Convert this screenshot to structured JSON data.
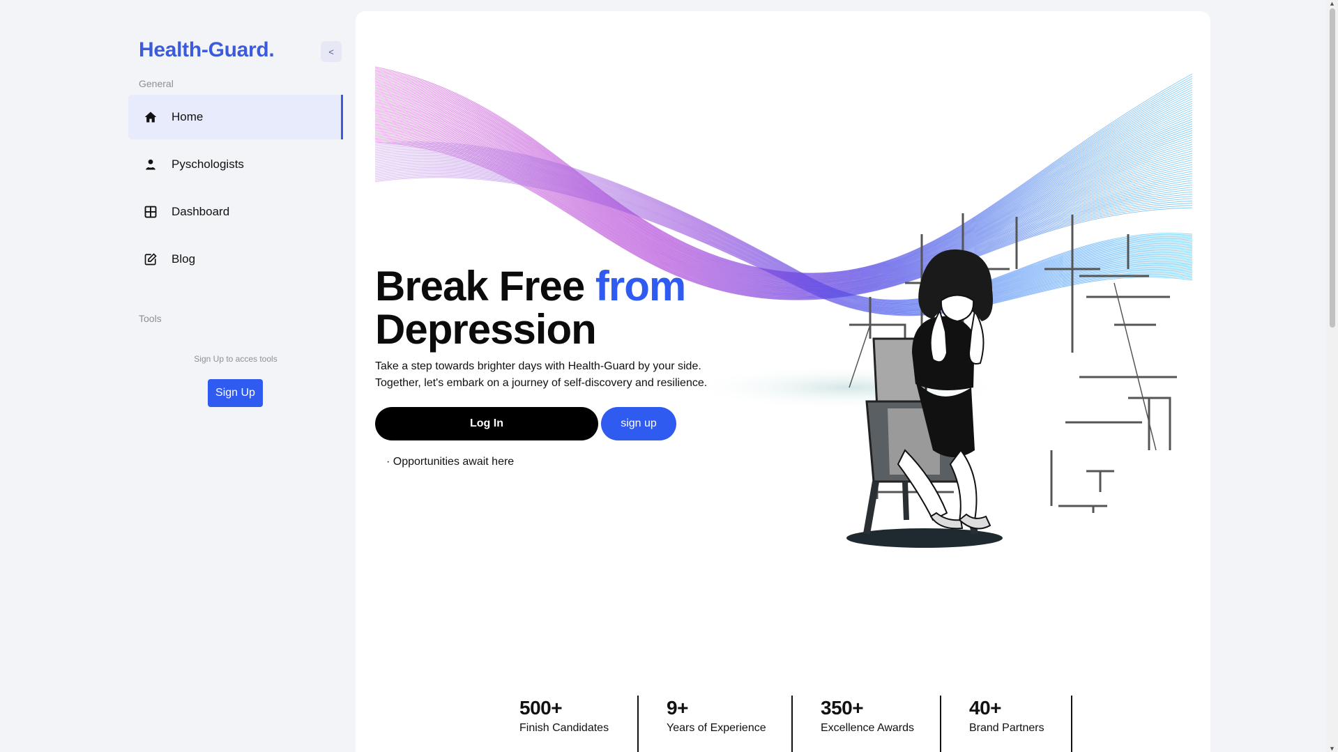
{
  "brand": "Health-Guard.",
  "collapse_label": "<",
  "sidebar": {
    "general_label": "General",
    "items": [
      {
        "label": "Home",
        "icon": "home-icon",
        "active": true
      },
      {
        "label": "Pyschologists",
        "icon": "user-icon",
        "active": false
      },
      {
        "label": "Dashboard",
        "icon": "grid-icon",
        "active": false
      },
      {
        "label": "Blog",
        "icon": "edit-icon",
        "active": false
      }
    ],
    "tools_label": "Tools",
    "tools_note": "Sign Up to acces tools",
    "signup_button": "Sign Up"
  },
  "hero": {
    "title_part1": "Break Free ",
    "title_accent": "from",
    "title_part2": "Depression",
    "description": "Take a step towards brighter days with Health-Guard by your side. Together, let's embark on a journey of self-discovery and resilience.",
    "login_button": "Log In",
    "signup_button": "sign up",
    "note": "· Opportunities await here"
  },
  "stats": [
    {
      "value": "500+",
      "label": "Finish Candidates"
    },
    {
      "value": "9+",
      "label": "Years of Experience"
    },
    {
      "value": "350+",
      "label": "Excellence Awards"
    },
    {
      "value": "40+",
      "label": "Brand Partners"
    }
  ],
  "colors": {
    "accent": "#2f5bf0",
    "brand": "#3b5bdb",
    "background": "#f3f4f7",
    "active_item": "#e7ebfb"
  }
}
